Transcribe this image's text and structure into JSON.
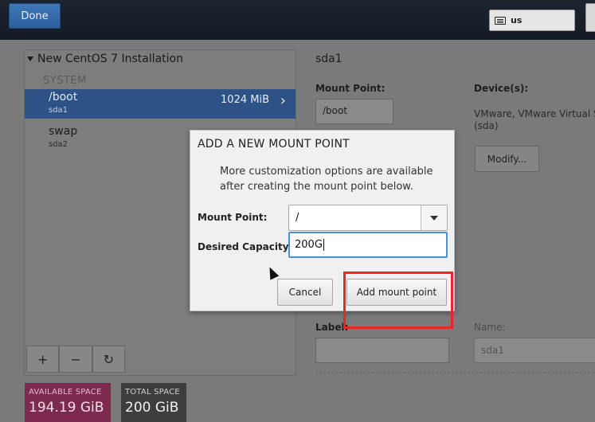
{
  "header": {
    "done_label": "Done",
    "keyboard_label": "us"
  },
  "left_panel": {
    "title": "New CentOS 7 Installation",
    "group_label": "SYSTEM",
    "rows": [
      {
        "name": "/boot",
        "device": "sda1",
        "size": "1024 MiB"
      },
      {
        "name": "swap",
        "device": "sda2",
        "size": ""
      }
    ],
    "toolbar": {
      "add": "+",
      "remove": "−",
      "reset": "↻"
    },
    "available_space_label": "AVAILABLE SPACE",
    "available_space_value": "194.19 GiB",
    "total_space_label": "TOTAL SPACE",
    "total_space_value": "200 GiB"
  },
  "detail_panel": {
    "title": "sda1",
    "mount_point_label": "Mount Point:",
    "mount_point_value": "/boot",
    "devices_label": "Device(s):",
    "devices_text": "VMware, VMware Virtual S (sda)",
    "modify_label": "Modify...",
    "label_label": "Label:",
    "name_label": "Name:",
    "name_value": "sda1"
  },
  "dialog": {
    "title": "ADD A NEW MOUNT POINT",
    "description": "More customization options are available after creating the mount point below.",
    "mount_point_label": "Mount Point:",
    "mount_point_value": "/",
    "capacity_label": "Desired Capacity:",
    "capacity_value": "200G",
    "cancel_label": "Cancel",
    "add_label": "Add mount point"
  },
  "colors": {
    "highlight": "#e8262b",
    "selected_row": "#2d5285",
    "available_space": "#7e2a4f",
    "focus_border": "#4a90d9"
  }
}
